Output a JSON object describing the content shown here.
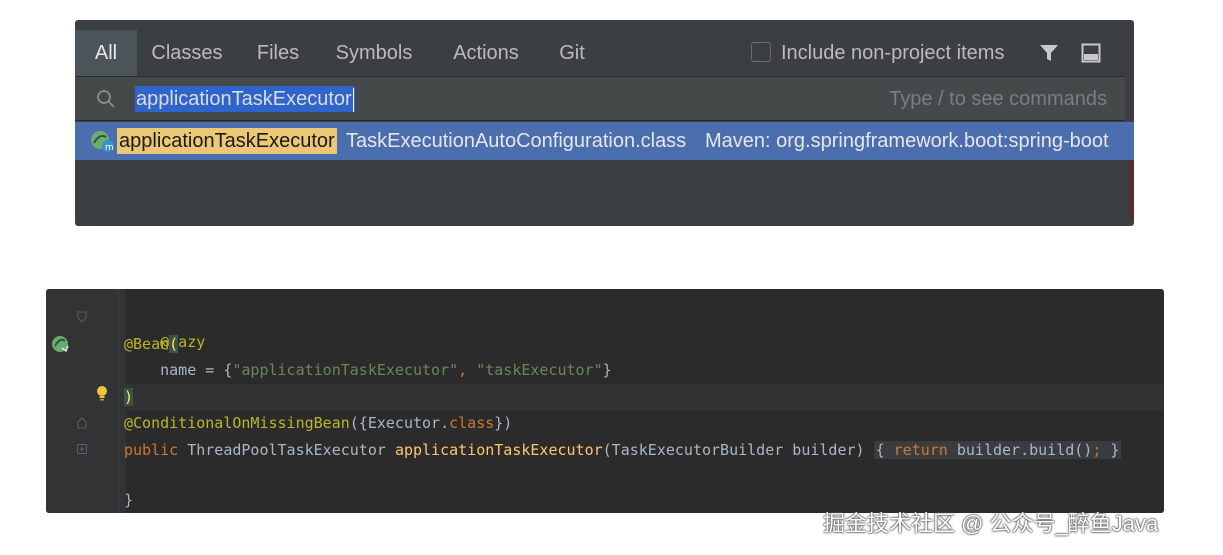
{
  "popup": {
    "tabs": [
      {
        "label": "All",
        "active": true
      },
      {
        "label": "Classes",
        "active": false
      },
      {
        "label": "Files",
        "active": false
      },
      {
        "label": "Symbols",
        "active": false
      },
      {
        "label": "Actions",
        "active": false
      },
      {
        "label": "Git",
        "active": false
      }
    ],
    "include_non_project": {
      "label": "Include non-project items",
      "checked": false
    },
    "search": {
      "value": "applicationTaskExecutor",
      "hint": "Type / to see commands"
    },
    "result": {
      "name": "applicationTaskExecutor",
      "file": "TaskExecutionAutoConfiguration.class",
      "location": "Maven: org.springframework.boot:spring-boot"
    },
    "icons": [
      "filter-icon",
      "preview-icon",
      "search-icon",
      "bean-method-icon"
    ],
    "colors": {
      "background": "#3c3f41",
      "selection": "#4b6eaf",
      "match_highlight": "#ebc876"
    }
  },
  "editor": {
    "lines": {
      "l1_anno": "@Lazy",
      "l2_anno": "@Bean",
      "l2_paren": "(",
      "l3_a": "    name = {",
      "l3_s1": "\"applicationTaskExecutor\"",
      "l3_comma": ", ",
      "l3_s2": "\"taskExecutor\"",
      "l3_b": "}",
      "l4_paren": ")",
      "l5_anno": "@ConditionalOnMissingBean",
      "l5_a": "({Executor.",
      "l5_kw": "class",
      "l5_b": "})",
      "l6_kw": "public",
      "l6_type": " ThreadPoolTaskExecutor ",
      "l6_meth": "applicationTaskExecutor",
      "l6_params": "(TaskExecutorBuilder builder) ",
      "l6_f1": "{",
      "l6_ret": "return",
      "l6_body": " builder.build()",
      "l6_semi": ";",
      "l6_f2": "}",
      "l7": "}"
    },
    "icons": [
      "bean-icon",
      "lightbulb-icon",
      "fold-icon"
    ],
    "colors": {
      "background": "#2b2b2b",
      "annotation": "#bbb529",
      "string": "#6a8759",
      "keyword": "#cc7832",
      "method": "#ffc66d"
    }
  },
  "watermark": "掘金技术社区 @ 公众号_醉鱼Java"
}
